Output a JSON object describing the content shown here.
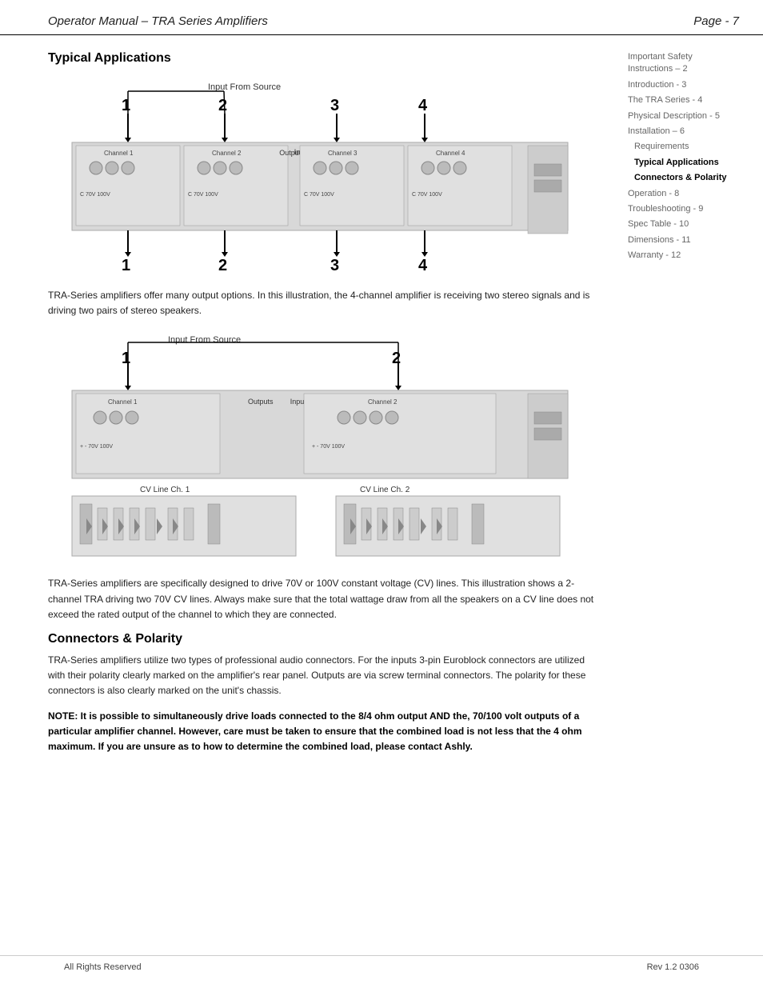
{
  "header": {
    "title": "Operator Manual – TRA Series Amplifiers",
    "page": "Page - 7"
  },
  "sidebar": {
    "items": [
      {
        "id": "safety",
        "label": "Important Safety Instructions – 2",
        "active": false
      },
      {
        "id": "intro",
        "label": "Introduction - 3",
        "active": false
      },
      {
        "id": "tra",
        "label": "The TRA Series - 4",
        "active": false
      },
      {
        "id": "physical",
        "label": "Physical Description - 5",
        "active": false
      },
      {
        "id": "installation",
        "label": "Installation – 6",
        "active": false
      },
      {
        "id": "requirements",
        "label": "Requirements",
        "active": false
      },
      {
        "id": "typical",
        "label": "Typical Applications",
        "active": true
      },
      {
        "id": "connectors",
        "label": "Connectors & Polarity",
        "active": true
      },
      {
        "id": "operation",
        "label": "Operation - 8",
        "active": false
      },
      {
        "id": "troubleshooting",
        "label": "Troubleshooting - 9",
        "active": false
      },
      {
        "id": "spec",
        "label": "Spec Table - 10",
        "active": false
      },
      {
        "id": "dimensions",
        "label": "Dimensions - 11",
        "active": false
      },
      {
        "id": "warranty",
        "label": "Warranty - 12",
        "active": false
      }
    ]
  },
  "sections": {
    "typical_applications": {
      "heading": "Typical Applications",
      "diagram1": {
        "input_label": "Input From Source",
        "numbers_top": [
          "1",
          "2",
          "3",
          "4"
        ],
        "numbers_bottom": [
          "1",
          "2",
          "3",
          "4"
        ]
      },
      "para1": "TRA-Series amplifiers offer many output options. In this illustration, the 4-channel amplifier is receiving two stereo signals and is driving two pairs of stereo speakers.",
      "diagram2": {
        "input_label": "Input From Source",
        "numbers_top": [
          "1",
          "2"
        ],
        "cv_labels": [
          "CV Line Ch. 1",
          "CV Line Ch. 2"
        ]
      },
      "para2": "TRA-Series amplifiers are specifically designed to drive 70V or 100V constant voltage (CV) lines.  This illustration shows a 2-channel TRA driving two 70V CV lines.  Always make sure that the total wattage draw from all the speakers on a CV line does not exceed the rated output of the channel to which they are connected."
    },
    "connectors": {
      "heading": "Connectors & Polarity",
      "para1": "TRA-Series amplifiers utilize two types of professional audio connectors.  For the inputs 3-pin Euroblock connectors are utilized with their polarity clearly marked on the amplifier's rear panel.  Outputs are via screw terminal connectors.  The polarity for these connectors is also clearly marked on the unit's chassis.",
      "note": "NOTE: It is possible to simultaneously drive loads connected to the 8/4 ohm output AND the, 70/100 volt outputs of a particular amplifier channel.  However, care must be taken to ensure that the combined load is not less that the 4 ohm maximum.  If you are unsure as to how to determine the combined load, please contact Ashly."
    }
  },
  "footer": {
    "left": "All Rights Reserved",
    "right": "Rev 1.2 0306"
  }
}
